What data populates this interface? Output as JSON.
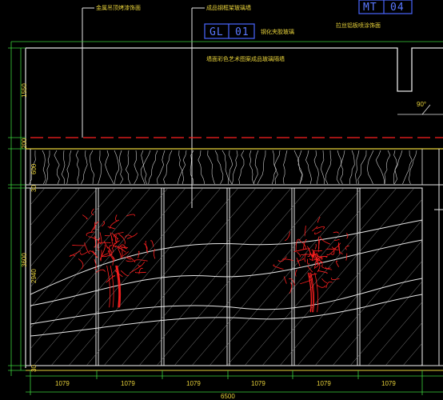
{
  "drawing": {
    "tags": [
      {
        "code": "MT",
        "num": "04"
      },
      {
        "code": "GL",
        "num": "01"
      }
    ],
    "notes": {
      "ceiling": "金属吊顶烤漆饰面",
      "panel": "成品钢框架玻璃墙",
      "glass": "钢化夹胶玻璃",
      "metal": "拉丝铝板喷涂饰面",
      "wall": "墙面彩色艺术图案成品玻璃隔墙"
    },
    "angle": "90°",
    "dims_vertical": [
      "1550",
      "200",
      "600",
      "30",
      "3600",
      "2940",
      "30"
    ],
    "dims_horizontal": [
      "1079",
      "1079",
      "1079",
      "1079",
      "1079",
      "1079"
    ],
    "dim_total": "6500"
  },
  "colors": {
    "line_white": "#e6e6e6",
    "line_yellow": "#e8d23a",
    "line_red": "#ff2020",
    "line_blue": "#4a66ff",
    "line_green": "#3cd23c",
    "background": "#000000"
  }
}
